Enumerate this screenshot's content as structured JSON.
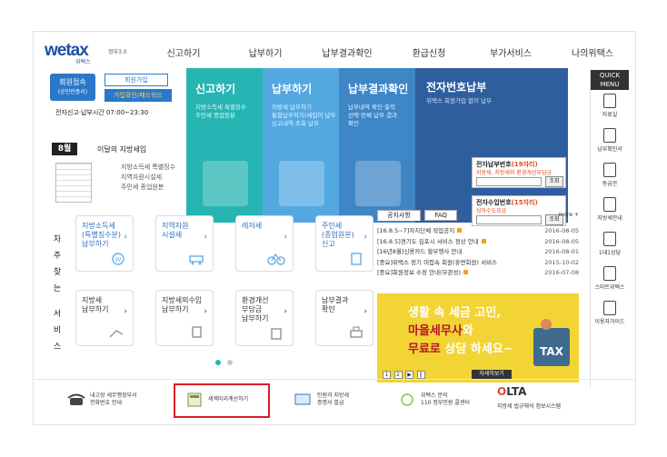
{
  "header": {
    "logo_main": "wetax",
    "logo_sub": "위택스",
    "logo_partner": "정부3.0",
    "nav": [
      "신고하기",
      "납부하기",
      "납부결과확인",
      "환급신청",
      "부가서비스",
      "나의위택스"
    ]
  },
  "login": {
    "member_line1": "회원접속",
    "member_line2": "(공인인증서)",
    "join": "회원가입",
    "check": "가입확인/패드워드",
    "file_hours": "전자신고·납부시간 07:00~23:30"
  },
  "monthly": {
    "badge": "8월",
    "title": "이달의 지방세입",
    "items": [
      "지방소득세 특별징수",
      "지역자원시설세",
      "주민세 종업원분"
    ]
  },
  "tiles": [
    {
      "title": "신고하기",
      "items": [
        "지방소득세 특별징수",
        "주민세 종업원분"
      ]
    },
    {
      "title": "납부하기",
      "items": [
        "지방세 납부하기",
        "통합납부하기(세입이 납부",
        "신고내역 조회 납부"
      ]
    },
    {
      "title": "납부결과확인",
      "items": [
        "납부내역 확인·출력",
        "선택·전체 납부 결과",
        "확인"
      ]
    }
  ],
  "electronic": {
    "title": "전자번호납부",
    "subtitle": "위택스 회원가입 없이 납부",
    "box1_label": "전자납부번호",
    "box1_hint": "(19자리)",
    "box1_note": "지방세, 지방세외 환경개선부담금",
    "box2_label": "전자수입번호",
    "box2_hint": "(15자리)",
    "box2_note": "상하수도요금",
    "search": "조회"
  },
  "quick_menu": {
    "title_line1": "QUICK",
    "title_line2": "MENU",
    "items": [
      "자료실",
      "납부확인서",
      "동급관",
      "지방세안내",
      "1대1상담",
      "스마트위택스",
      "이용자가이드"
    ]
  },
  "services": {
    "side_label": [
      "자",
      "주",
      "찾",
      "는",
      "서",
      "비",
      "스"
    ],
    "row1": [
      {
        "line1": "지방소득세",
        "line2": "(특별징수분)",
        "line3": "납부하기"
      },
      {
        "line1": "지역자원",
        "line2": "시설세",
        "line3": ""
      },
      {
        "line1": "레저세",
        "line2": "",
        "line3": ""
      },
      {
        "line1": "주민세",
        "line2": "(종업원분)",
        "line3": "신고"
      }
    ],
    "row2": [
      {
        "line1": "지방세",
        "line2": "납부하기",
        "line3": ""
      },
      {
        "line1": "지방세외수입",
        "line2": "납부하기",
        "line3": ""
      },
      {
        "line1": "환경개선",
        "line2": "부담금",
        "line3": "납부하기"
      },
      {
        "line1": "납부결과",
        "line2": "확인",
        "line3": ""
      }
    ]
  },
  "notice": {
    "tab_active": "공지사항",
    "tab_other": "FAQ",
    "more": "more +",
    "items": [
      {
        "title": "[16.8.5~7]자치단체 작업공지",
        "date": "2016-08-05"
      },
      {
        "title": "[16.8.5]경기도 김포시 서비스 정상 안내",
        "date": "2016-08-05"
      },
      {
        "title": "[16년8월]신용카드 할부행사 안내",
        "date": "2016-08-01"
      },
      {
        "title": "[중요]위택스 정기 미접속 회원(휴면회원) 서비스",
        "date": "2015-10-02"
      },
      {
        "title": "[중요]회원정보 수정 안내(무관성)",
        "date": "2016-07-08"
      }
    ]
  },
  "banner": {
    "line1": "생활 속 세금 고민,",
    "line2a": "마을세무사",
    "line2b": "와",
    "line3a": "무료로",
    "line3b": "상담 하세요~",
    "pages": [
      "1",
      "2",
      "▶",
      "∥"
    ],
    "detail": "자세히보기",
    "tax": "TAX"
  },
  "footer": {
    "b1_line1": "내고장 세무행정부서",
    "b1_line2": "전화번호 안내",
    "b2_line1": "세액미리계산하기",
    "b3_line1": "민원과 지방세",
    "b3_line2": "증명서 발급",
    "b4_line1": "위택스 문의",
    "b4_line2": "110 정부민원 콜센터",
    "b5_logo_a": "O",
    "b5_logo_b": "LTA",
    "b5_line": "지방세 법규해석 정보시스템"
  },
  "colors": {
    "brand_blue": "#1e4fa3",
    "tile_teal": "#27b5b3",
    "tile_sky": "#54a8e0",
    "tile_blue": "#3e86c6",
    "tile_navy": "#2f5e9e",
    "highlight_red": "#d91f26",
    "banner_yellow": "#f2d434"
  }
}
